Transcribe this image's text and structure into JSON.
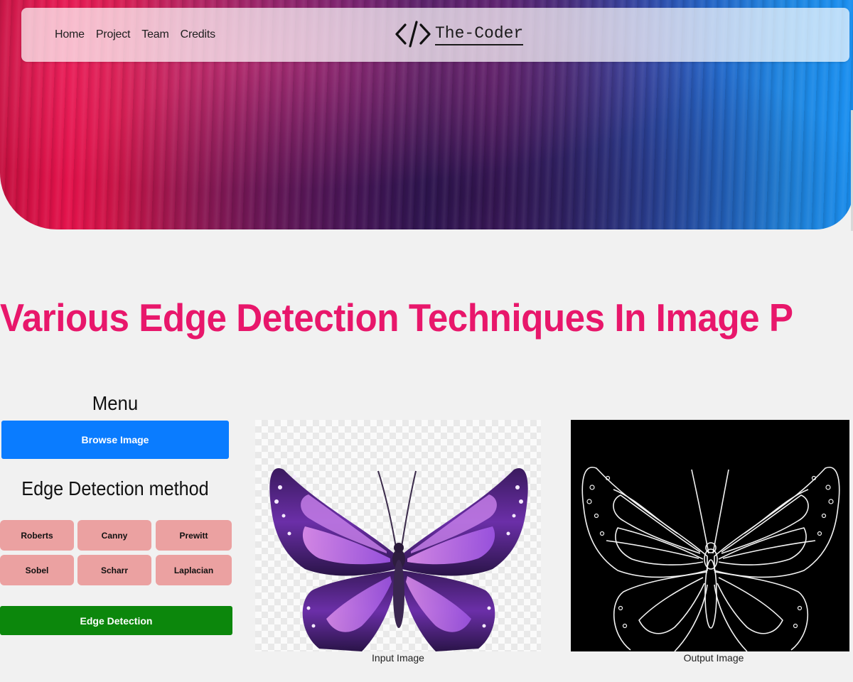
{
  "nav": {
    "links": [
      "Home",
      "Project",
      "Team",
      "Credits"
    ],
    "brand": "The-Coder",
    "brand_icon": "code-brackets-icon"
  },
  "heading": "Various Edge Detection Techniques In Image Processin",
  "menu": {
    "title": "Menu",
    "browse_label": "Browse Image",
    "method_title": "Edge Detection method",
    "methods": [
      "Roberts",
      "Canny",
      "Prewitt",
      "Sobel",
      "Scharr",
      "Laplacian"
    ],
    "detect_label": "Edge Detection"
  },
  "images": {
    "input_caption": "Input Image",
    "output_caption": "Output Image"
  },
  "colors": {
    "heading": "#e8176b",
    "browse_button": "#0a7cff",
    "method_button": "#eba1a1",
    "detect_button": "#0c870c"
  }
}
